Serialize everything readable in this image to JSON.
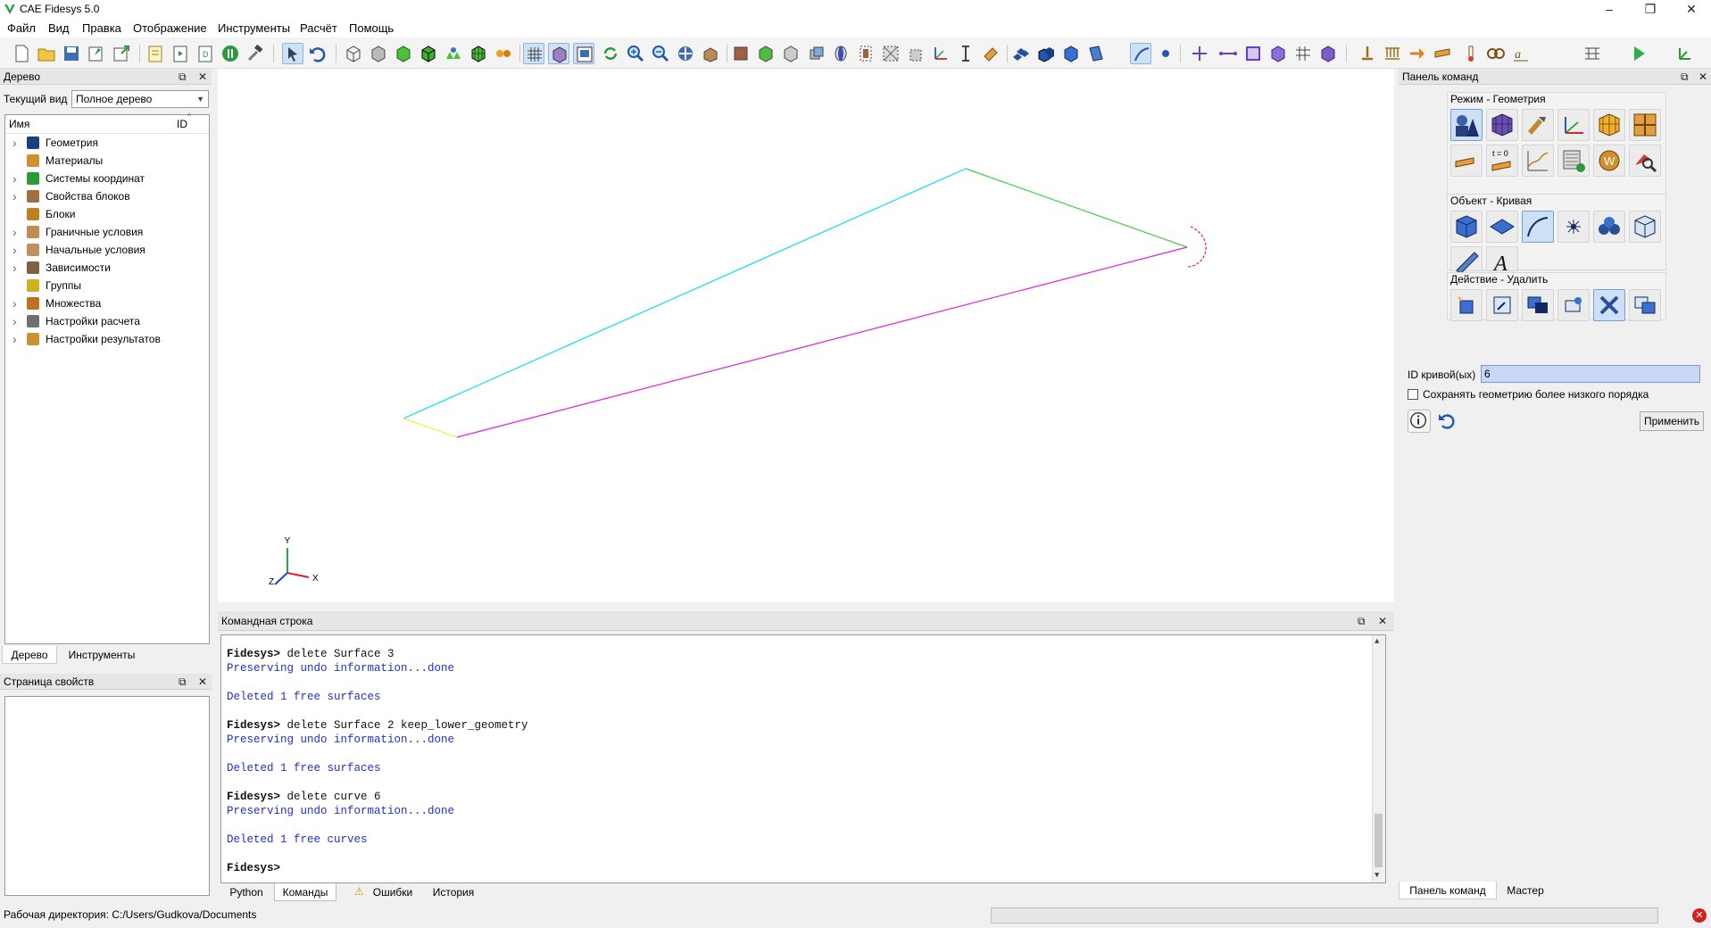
{
  "window": {
    "title": "CAE Fidesys 5.0",
    "minimize": "–",
    "restore": "❐",
    "close": "✕"
  },
  "menu": [
    "Файл",
    "Вид",
    "Правка",
    "Отображение",
    "Инструменты",
    "Расчёт",
    "Помощь"
  ],
  "tree_panel": {
    "title": "Дерево",
    "current_view_label": "Текущий вид",
    "current_view_value": "Полное дерево",
    "col_name": "Имя",
    "col_id": "ID",
    "items": [
      {
        "label": "Геометрия",
        "icon": "geometry-icon",
        "expandable": true
      },
      {
        "label": "Материалы",
        "icon": "materials-icon",
        "expandable": false
      },
      {
        "label": "Системы координат",
        "icon": "coordinate-systems-icon",
        "expandable": true
      },
      {
        "label": "Свойства блоков",
        "icon": "block-properties-icon",
        "expandable": true
      },
      {
        "label": "Блоки",
        "icon": "blocks-icon",
        "expandable": false
      },
      {
        "label": "Граничные условия",
        "icon": "boundary-conditions-icon",
        "expandable": true
      },
      {
        "label": "Начальные условия",
        "icon": "initial-conditions-icon",
        "expandable": true
      },
      {
        "label": "Зависимости",
        "icon": "dependencies-icon",
        "expandable": true
      },
      {
        "label": "Группы",
        "icon": "groups-icon",
        "expandable": false
      },
      {
        "label": "Множества",
        "icon": "sets-icon",
        "expandable": true
      },
      {
        "label": "Настройки расчета",
        "icon": "calc-settings-icon",
        "expandable": true
      },
      {
        "label": "Настройки результатов",
        "icon": "result-settings-icon",
        "expandable": true
      }
    ],
    "tabs": [
      "Дерево",
      "Инструменты"
    ]
  },
  "properties_panel": {
    "title": "Страница свойств"
  },
  "command_line": {
    "title": "Командная строка",
    "lines": [
      {
        "type": "prompt",
        "text": "Fidesys> delete Surface 3"
      },
      {
        "type": "info",
        "text": "Preserving undo information...done"
      },
      {
        "type": "blank",
        "text": ""
      },
      {
        "type": "info",
        "text": "Deleted 1 free surfaces"
      },
      {
        "type": "blank",
        "text": ""
      },
      {
        "type": "prompt",
        "text": "Fidesys> delete Surface 2 keep_lower_geometry"
      },
      {
        "type": "info",
        "text": "Preserving undo information...done"
      },
      {
        "type": "blank",
        "text": ""
      },
      {
        "type": "info",
        "text": "Deleted 1 free surfaces"
      },
      {
        "type": "blank",
        "text": ""
      },
      {
        "type": "prompt",
        "text": "Fidesys> delete curve 6"
      },
      {
        "type": "info",
        "text": "Preserving undo information...done"
      },
      {
        "type": "blank",
        "text": ""
      },
      {
        "type": "info",
        "text": "Deleted 1 free curves"
      },
      {
        "type": "blank",
        "text": ""
      },
      {
        "type": "prompt",
        "text": "Fidesys> "
      }
    ],
    "tabs": [
      "Python",
      "Команды",
      "Ошибки",
      "История"
    ]
  },
  "command_panel": {
    "title": "Панель команд",
    "mode_label": "Режим - Геометрия",
    "object_label": "Объект - Кривая",
    "action_label": "Действие - Удалить",
    "curve_id_label": "ID кривой(ых)",
    "curve_id_value": "6",
    "keep_lower_label": "Сохранять геометрию более низкого порядка",
    "apply_label": "Применить",
    "tabs": [
      "Панель команд",
      "Мастер"
    ],
    "t0_label": "t = 0"
  },
  "axes": {
    "x": "X",
    "y": "Y",
    "z": "Z"
  },
  "status": {
    "workdir": "Рабочая директория: C:/Users/Gudkova/Documents"
  },
  "colors": {
    "curve_cyan": "#00e0f0",
    "curve_green": "#40d040",
    "curve_magenta": "#e020e0",
    "curve_yellow": "#f0f040",
    "curve_red": "#e02020",
    "accent": "#2030d0"
  }
}
